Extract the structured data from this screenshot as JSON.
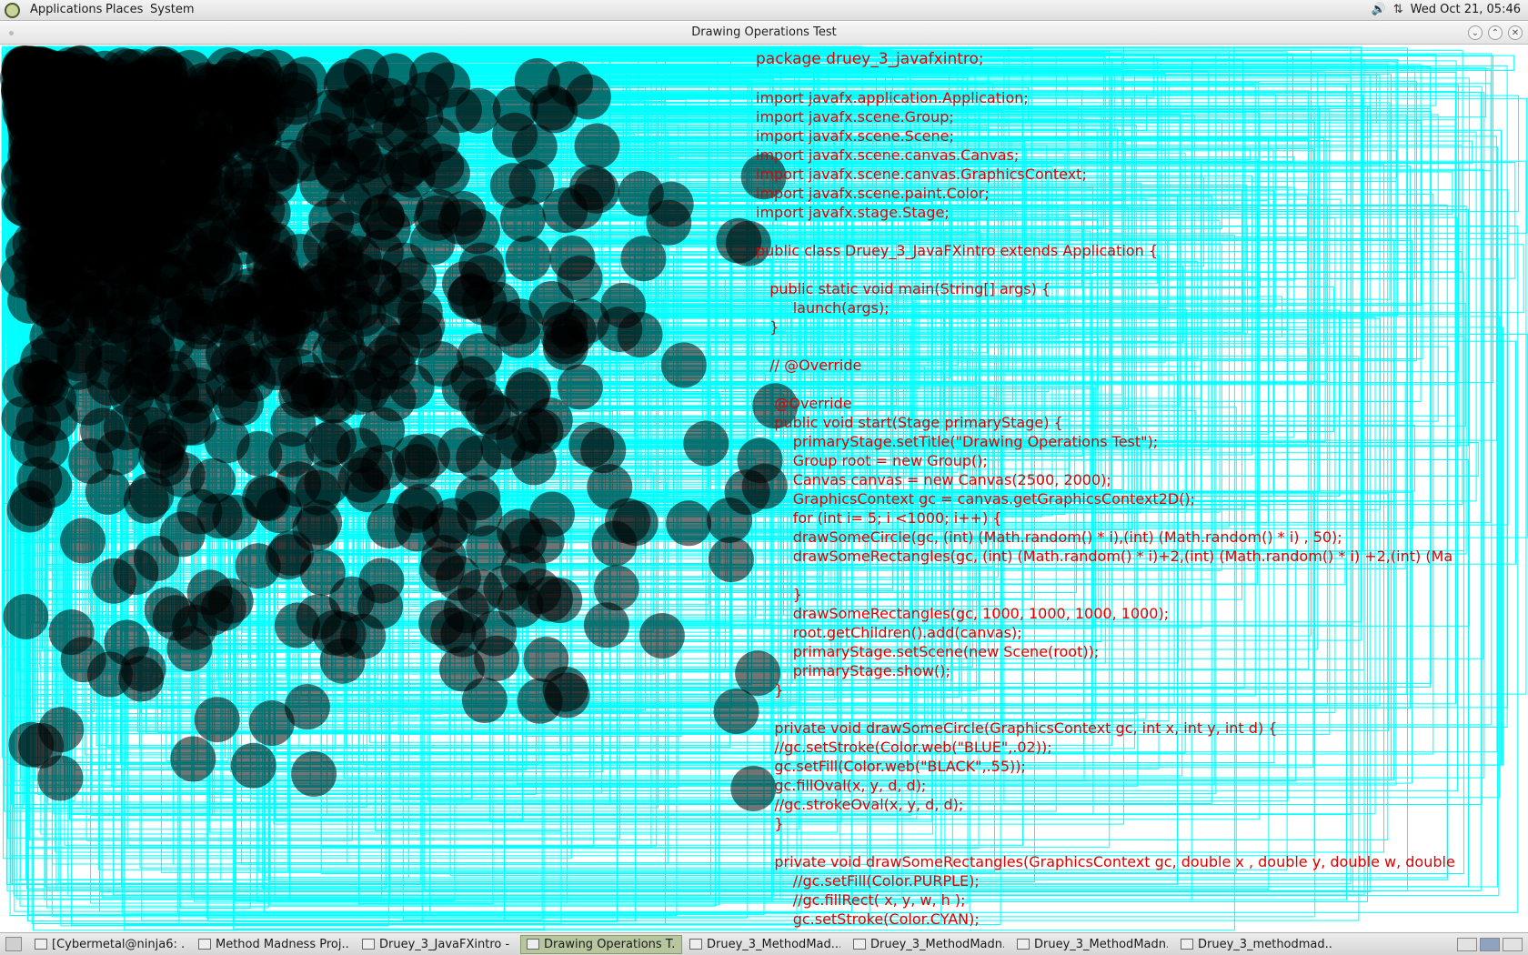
{
  "top_panel": {
    "menus": [
      "Applications",
      "Places",
      "System"
    ],
    "datetime": "Wed Oct 21, 05:46",
    "tray_icons": [
      "volume-icon",
      "network-icon"
    ]
  },
  "window": {
    "title": "Drawing Operations Test",
    "controls": [
      "minimize",
      "maximize",
      "close"
    ]
  },
  "canvas": {
    "circle_fill": "#000000",
    "circle_opacity": 0.55,
    "rect_stroke": "#00ffff"
  },
  "code_lines": [
    "package druey_3_javafxintro;",
    "",
    "import javafx.application.Application;",
    "import javafx.scene.Group;",
    "import javafx.scene.Scene;",
    "import javafx.scene.canvas.Canvas;",
    "import javafx.scene.canvas.GraphicsContext;",
    "import javafx.scene.paint.Color;",
    "import javafx.stage.Stage;",
    "",
    "public class Druey_3_JavaFXintro extends Application {",
    "",
    "   public static void main(String[] args) {",
    "        launch(args);",
    "   }",
    "",
    "   // @Override",
    "",
    "    @Override",
    "    public void start(Stage primaryStage) {",
    "        primaryStage.setTitle(\"Drawing Operations Test\");",
    "        Group root = new Group();",
    "        Canvas canvas = new Canvas(2500, 2000);",
    "        GraphicsContext gc = canvas.getGraphicsContext2D();",
    "        for (int i= 5; i <1000; i++) {",
    "        drawSomeCircle(gc, (int) (Math.random() * i),(int) (Math.random() * i) , 50);",
    "        drawSomeRectangles(gc, (int) (Math.random() * i)+2,(int) (Math.random() * i) +2,(int) (Ma",
    "",
    "        }",
    "        drawSomeRectangles(gc, 1000, 1000, 1000, 1000);",
    "        root.getChildren().add(canvas);",
    "        primaryStage.setScene(new Scene(root));",
    "        primaryStage.show();",
    "    }",
    "",
    "    private void drawSomeCircle(GraphicsContext gc, int x, int y, int d) {",
    "    //gc.setStroke(Color.web(\"BLUE\",.02));",
    "    gc.setFill(Color.web(\"BLACK\",.55));",
    "    gc.fillOval(x, y, d, d);",
    "    //gc.strokeOval(x, y, d, d);",
    "    }",
    "",
    "    private void drawSomeRectangles(GraphicsContext gc, double x , double y, double w, double",
    "        //gc.setFill(Color.PURPLE);",
    "        //gc.fillRect( x, y, w, h );",
    "        gc.setStroke(Color.CYAN);",
    "        gc.strokeRect( x, y, w, h);",
    "    }"
  ],
  "taskbar": {
    "tasks": [
      {
        "label": "[Cybermetal@ninja6: ...",
        "icon": "terminal-icon",
        "active": false
      },
      {
        "label": "Method Madness Proj...",
        "icon": "browser-icon",
        "active": false
      },
      {
        "label": "Druey_3_JavaFXintro - ...",
        "icon": "netbeans-icon",
        "active": false
      },
      {
        "label": "Drawing Operations T...",
        "icon": "window-icon",
        "active": true
      },
      {
        "label": "Druey_3_MethodMad...",
        "icon": "window-icon",
        "active": false
      },
      {
        "label": "Druey_3_MethodMadn...",
        "icon": "window-icon",
        "active": false
      },
      {
        "label": "Druey_3_MethodMadn...",
        "icon": "window-icon",
        "active": false
      },
      {
        "label": "Druey_3_methodmad...",
        "icon": "window-icon",
        "active": false
      }
    ]
  }
}
